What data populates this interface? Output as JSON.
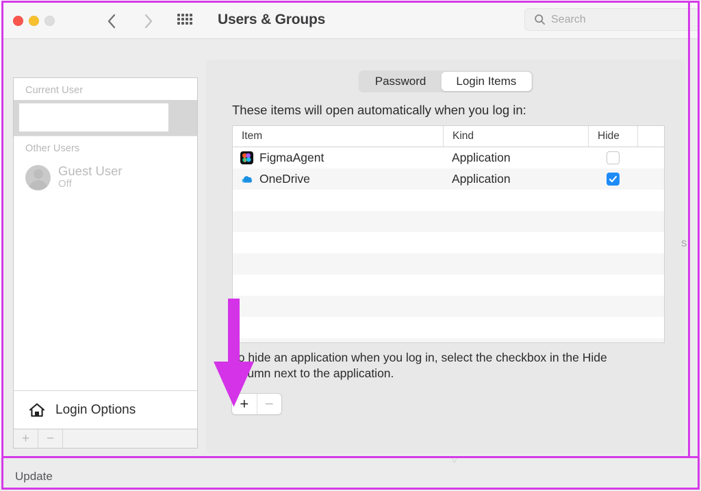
{
  "window": {
    "title": "Users & Groups",
    "traffic_lights": [
      "close-red",
      "minimize-yellow",
      "zoom-gray"
    ],
    "nav": {
      "back_icon": "chevron-left-icon",
      "forward_icon": "chevron-right-icon",
      "grid_icon": "show-all-grid-icon"
    }
  },
  "search": {
    "placeholder": "Search",
    "icon": "search-icon"
  },
  "sidebar": {
    "current_user_group_label": "Current User",
    "current_user_name": "",
    "other_users_group_label": "Other Users",
    "other_users": [
      {
        "name": "Guest User",
        "status": "Off",
        "avatar": "guest-avatar-icon"
      }
    ],
    "login_options_label": "Login Options",
    "login_options_icon": "home-icon",
    "toolbar": {
      "add_label": "+",
      "remove_label": "−"
    }
  },
  "panel": {
    "tabs": [
      {
        "label": "Password",
        "active": false
      },
      {
        "label": "Login Items",
        "active": true
      }
    ],
    "intro_text": "These items will open automatically when you log in:",
    "table": {
      "columns": [
        "Item",
        "Kind",
        "Hide"
      ],
      "rows": [
        {
          "item": "FigmaAgent",
          "kind": "Application",
          "hide": false,
          "icon": "figma-app-icon"
        },
        {
          "item": "OneDrive",
          "kind": "Application",
          "hide": true,
          "icon": "onedrive-cloud-icon"
        }
      ],
      "empty_row_count": 8
    },
    "footnote": "To hide an application when you log in, select the checkbox in the Hide column next to the application.",
    "add_button_label": "+",
    "remove_button_label": "−"
  },
  "annotation": {
    "arrow_color": "#D43BE8",
    "frame_color": "#D43BE8",
    "arrow_points_to": "add-login-item-button"
  },
  "misc": {
    "edge_clipped_text": "s",
    "update_label": "Update"
  },
  "colors": {
    "accent_blue": "#1E8CF7",
    "window_bg": "#ECECEC",
    "panel_bg": "#E8E8E8",
    "magenta": "#D43BE8"
  }
}
